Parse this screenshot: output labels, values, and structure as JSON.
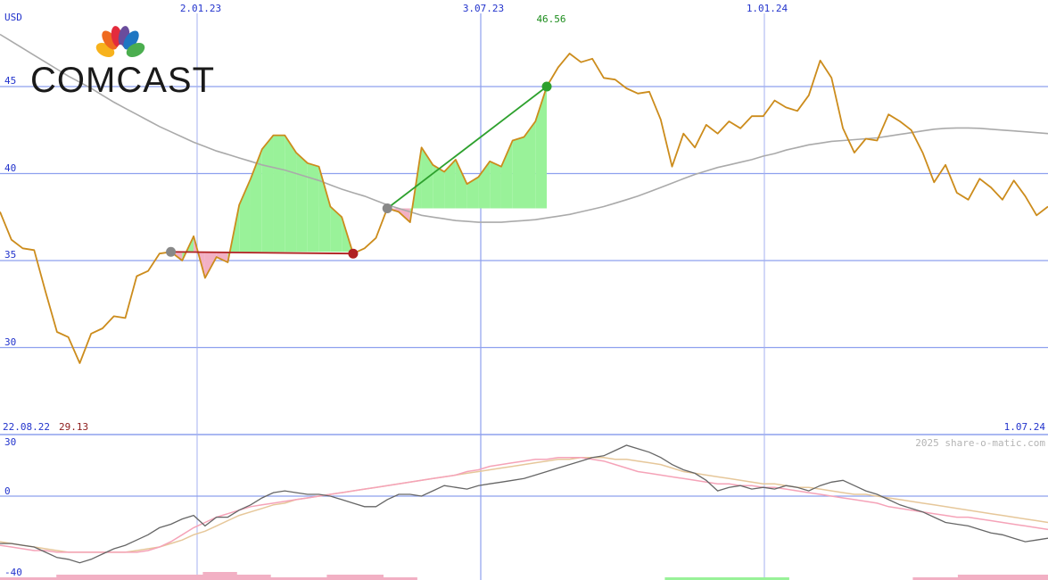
{
  "chart_data": {
    "type": "line",
    "currency": "USD",
    "x_tick_labels": [
      "2.01.23",
      "3.07.23",
      "1.01.24"
    ],
    "y_ticks": [
      30,
      35,
      40,
      45
    ],
    "ylim": [
      26.5,
      49
    ],
    "date_range": {
      "start": "22.08.22",
      "end": "1.07.24"
    },
    "min_value": "29.13",
    "max_value": "46.56",
    "price": [
      37.8,
      36.2,
      35.7,
      35.6,
      33.2,
      30.9,
      30.6,
      29.1,
      30.8,
      31.1,
      31.8,
      31.7,
      34.1,
      34.4,
      35.4,
      35.5,
      35.0,
      36.4,
      34.0,
      35.2,
      34.9,
      38.2,
      39.7,
      41.4,
      42.2,
      42.2,
      41.2,
      40.6,
      40.4,
      38.1,
      37.5,
      35.4,
      35.7,
      36.3,
      38.0,
      37.8,
      37.2,
      41.5,
      40.5,
      40.1,
      40.8,
      39.4,
      39.8,
      40.7,
      40.4,
      41.9,
      42.1,
      43.0,
      45.0,
      46.1,
      46.9,
      46.4,
      46.6,
      45.5,
      45.4,
      44.9,
      44.6,
      44.7,
      43.1,
      40.4,
      42.3,
      41.5,
      42.8,
      42.3,
      43.0,
      42.6,
      43.3,
      43.3,
      44.2,
      43.8,
      43.6,
      44.5,
      46.5,
      45.5,
      42.6,
      41.2,
      42.0,
      41.9,
      43.4,
      43.0,
      42.5,
      41.2,
      39.5,
      40.5,
      38.9,
      38.5,
      39.7,
      39.2,
      38.5,
      39.6,
      38.7,
      37.6,
      38.1
    ],
    "moving_average": [
      48.0,
      47.6,
      47.2,
      46.8,
      46.4,
      46.0,
      45.6,
      45.25,
      44.9,
      44.5,
      44.1,
      43.75,
      43.4,
      43.05,
      42.7,
      42.4,
      42.1,
      41.8,
      41.55,
      41.3,
      41.1,
      40.9,
      40.7,
      40.5,
      40.35,
      40.2,
      40.0,
      39.8,
      39.6,
      39.35,
      39.1,
      38.9,
      38.7,
      38.45,
      38.2,
      38.0,
      37.8,
      37.6,
      37.5,
      37.4,
      37.3,
      37.25,
      37.2,
      37.2,
      37.2,
      37.25,
      37.3,
      37.35,
      37.45,
      37.55,
      37.65,
      37.8,
      37.95,
      38.1,
      38.3,
      38.5,
      38.7,
      38.95,
      39.2,
      39.45,
      39.7,
      39.95,
      40.15,
      40.35,
      40.5,
      40.65,
      40.8,
      41.0,
      41.15,
      41.35,
      41.5,
      41.65,
      41.75,
      41.85,
      41.9,
      41.95,
      42.0,
      42.05,
      42.15,
      42.25,
      42.35,
      42.45,
      42.55,
      42.6,
      42.62,
      42.62,
      42.6,
      42.55,
      42.5,
      42.45,
      42.4,
      42.35,
      42.3
    ],
    "trades": [
      {
        "buy": 35.5,
        "sell": 35.4,
        "result": "loss"
      },
      {
        "buy": 38.0,
        "sell": 45.0,
        "result": "gain"
      }
    ],
    "oscillator": {
      "ylim": [
        -40,
        30
      ],
      "y_ticks": [
        -40,
        0,
        30
      ],
      "line": [
        -27,
        -27,
        -28,
        -29,
        -32,
        -35,
        -36,
        -38,
        -36,
        -33,
        -30,
        -28,
        -25,
        -22,
        -18,
        -16,
        -13,
        -11,
        -17,
        -12,
        -12,
        -8,
        -5,
        -1,
        2,
        3,
        2,
        1,
        1,
        0,
        -2,
        -4,
        -6,
        -6,
        -2,
        1,
        1,
        0,
        3,
        6,
        5,
        4,
        6,
        7,
        8,
        9,
        10,
        12,
        14,
        16,
        18,
        20,
        22,
        23,
        26,
        29,
        27,
        25,
        22,
        18,
        15,
        13,
        9,
        3,
        5,
        6,
        4,
        5,
        4,
        6,
        5,
        3,
        6,
        8,
        9,
        6,
        3,
        1,
        -2,
        -5,
        -7,
        -9,
        -12,
        -15,
        -16,
        -17,
        -19,
        -21,
        -22,
        -24,
        -26,
        -25,
        -24
      ],
      "signal_fast": [
        -28,
        -29,
        -30,
        -31,
        -31,
        -32,
        -32,
        -32,
        -32,
        -32,
        -32,
        -32,
        -32,
        -31,
        -29,
        -26,
        -22,
        -18,
        -15,
        -12,
        -10,
        -8,
        -6,
        -5,
        -4,
        -3,
        -2,
        -1,
        0,
        1,
        2,
        3,
        4,
        5,
        6,
        7,
        8,
        9,
        10,
        11,
        12,
        14,
        15,
        17,
        18,
        19,
        20,
        21,
        21,
        22,
        22,
        22,
        21,
        20,
        18,
        16,
        14,
        13,
        12,
        11,
        10,
        9,
        8,
        7,
        7,
        6,
        6,
        5,
        5,
        4,
        3,
        2,
        1,
        0,
        -1,
        -2,
        -3,
        -4,
        -6,
        -7,
        -8,
        -9,
        -10,
        -11,
        -12,
        -12,
        -13,
        -14,
        -15,
        -16,
        -17,
        -18,
        -19
      ],
      "signal_slow": [
        -26,
        -27,
        -28,
        -29,
        -30,
        -31,
        -32,
        -32,
        -32,
        -32,
        -32,
        -32,
        -31,
        -30,
        -29,
        -27,
        -25,
        -22,
        -20,
        -17,
        -14,
        -11,
        -9,
        -7,
        -5,
        -4,
        -2,
        -1,
        0,
        1,
        2,
        3,
        4,
        5,
        6,
        7,
        8,
        9,
        10,
        11,
        12,
        13,
        14,
        15,
        16,
        17,
        18,
        19,
        20,
        21,
        21,
        22,
        22,
        22,
        21,
        21,
        20,
        19,
        18,
        16,
        14,
        13,
        12,
        11,
        10,
        9,
        8,
        7,
        7,
        6,
        5,
        5,
        4,
        3,
        2,
        1,
        1,
        0,
        -1,
        -2,
        -3,
        -4,
        -5,
        -6,
        -7,
        -8,
        -9,
        -10,
        -11,
        -12,
        -13,
        -14,
        -15
      ],
      "histogram": [
        -1,
        -1,
        -1,
        -1,
        -1,
        -2,
        -2,
        -2,
        -2,
        -2,
        -2,
        -2,
        -2,
        -2,
        -2,
        -2,
        -2,
        -2,
        -3,
        -3,
        -3,
        -2,
        -2,
        -2,
        -1,
        -1,
        -1,
        -1,
        -1,
        -2,
        -2,
        -2,
        -2,
        -2,
        -1,
        -1,
        -1,
        0,
        0,
        0,
        0,
        0,
        0,
        0,
        0,
        0,
        0,
        0,
        0,
        0,
        0,
        0,
        0,
        0,
        0,
        0,
        0,
        0,
        0,
        1,
        1,
        1,
        1,
        1,
        1,
        1,
        1,
        1,
        1,
        1,
        0,
        0,
        0,
        0,
        0,
        0,
        0,
        0,
        0,
        0,
        0,
        -1,
        -1,
        -1,
        -1,
        -2,
        -2,
        -2,
        -2,
        -2,
        -2,
        -2,
        -2
      ]
    },
    "credit": "2025 share-o-matic.com",
    "logo_text": "COMCAST",
    "colors": {
      "price": "#cc8c1c",
      "moving_average": "#aaaaaa",
      "gain_fill": "#99f299",
      "loss_fill": "#f2b0c4",
      "gain_trade": "#2ea12e",
      "loss_trade": "#b02020",
      "grid": "#8ea0ee",
      "label": "#2233cc",
      "max_label": "#1b8c1b",
      "min_label": "#8c1b1b",
      "osc_line": "#666666",
      "osc_fast": "#f5a3b8",
      "osc_slow": "#e6c79a"
    }
  }
}
